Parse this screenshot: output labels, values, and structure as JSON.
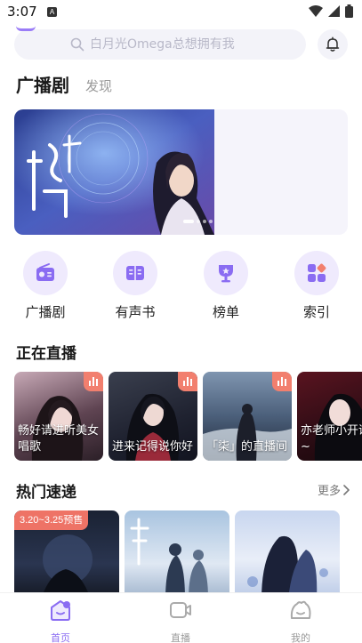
{
  "status_bar": {
    "time": "3:07",
    "app_badge": "A"
  },
  "search": {
    "placeholder": "白月光Omega总想拥有我"
  },
  "tabs": [
    {
      "label": "广播剧",
      "active": true
    },
    {
      "label": "发现",
      "active": false
    }
  ],
  "categories": [
    {
      "label": "广播剧",
      "icon": "radio-icon"
    },
    {
      "label": "有声书",
      "icon": "book-icon"
    },
    {
      "label": "榜单",
      "icon": "trophy-icon"
    },
    {
      "label": "索引",
      "icon": "grid-icon"
    }
  ],
  "live_section": {
    "title": "正在直播",
    "cards": [
      {
        "text": "畅好请进听美女唱歌"
      },
      {
        "text": "进来记得说你好"
      },
      {
        "text": "「柒」的直播间"
      },
      {
        "text": "亦老师小开课啦~"
      }
    ]
  },
  "hot_section": {
    "title": "热门速递",
    "more_label": "更多",
    "cards": [
      {
        "badge": "3.20~3.25预售"
      },
      {
        "badge": ""
      },
      {
        "badge": ""
      }
    ]
  },
  "bottom_nav": [
    {
      "label": "首页",
      "icon": "home-icon",
      "active": true
    },
    {
      "label": "直播",
      "icon": "live-camera-icon",
      "active": false
    },
    {
      "label": "我的",
      "icon": "profile-icon",
      "active": false
    }
  ],
  "colors": {
    "accent": "#8a6cf2",
    "category_bg": "#efeafd",
    "live_badge": "#f27f6e",
    "hot_badge": "#ee7366"
  }
}
